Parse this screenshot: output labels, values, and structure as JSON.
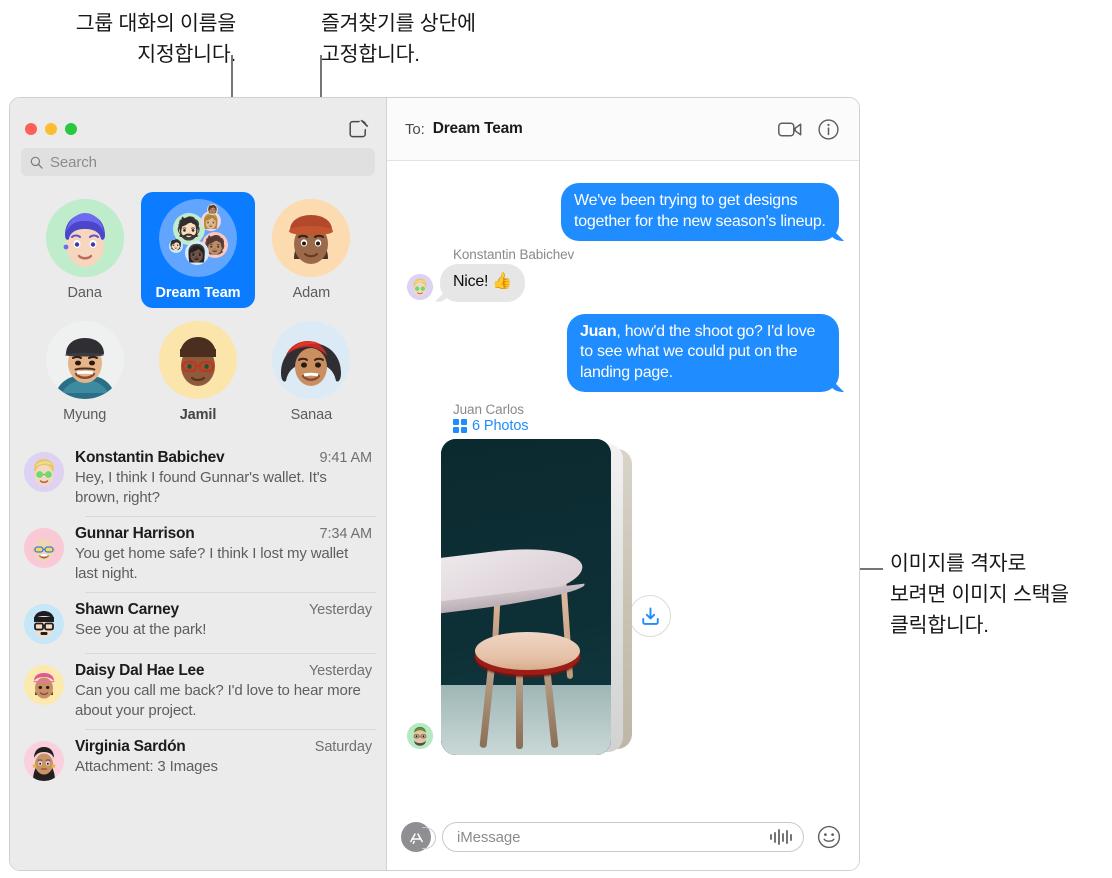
{
  "annotations": [
    {
      "id": "name-group",
      "text": "그룹 대화의 이름을\n지정합니다."
    },
    {
      "id": "pin-favorites",
      "text": "즐겨찾기를 상단에\n고정합니다."
    },
    {
      "id": "image-stack",
      "text": "이미지를 격자로\n보려면 이미지 스택을\n클릭합니다."
    }
  ],
  "window": {
    "titlebar": {
      "traffic_lights": [
        "close",
        "minimize",
        "zoom"
      ],
      "compose_icon": "compose-icon"
    },
    "search": {
      "placeholder": "Search",
      "icon": "search-icon"
    }
  },
  "pinned": {
    "items": [
      {
        "name": "Dana",
        "selected": false,
        "emoji": "👩🏻",
        "bg": "#bfeccb"
      },
      {
        "name": "Dream Team",
        "selected": true,
        "group": true,
        "bg": "#0b7bff"
      },
      {
        "name": "Adam",
        "selected": false,
        "emoji": "🧑🏽",
        "bg": "#fcdbb0"
      },
      {
        "name": "Myung",
        "selected": false,
        "emoji": "🧑🏻",
        "bg": "#f1f2f1"
      },
      {
        "name": "Jamil",
        "selected": false,
        "emoji": "👨🏾",
        "bg": "#fbe5ab"
      },
      {
        "name": "Sanaa",
        "selected": false,
        "emoji": "👩🏽",
        "bg": "#dceaf5"
      }
    ]
  },
  "conversations": [
    {
      "name": "Konstantin Babichev",
      "time": "9:41 AM",
      "preview": "Hey, I think I found Gunnar's wallet. It's brown, right?",
      "emoji": "🧑🏼",
      "bg": "#ddd2f2"
    },
    {
      "name": "Gunnar Harrison",
      "time": "7:34 AM",
      "preview": "You get home safe? I think I lost my wallet last night.",
      "emoji": "🧑🏼",
      "bg": "#f9c9d6"
    },
    {
      "name": "Shawn Carney",
      "time": "Yesterday",
      "preview": "See you at the park!",
      "emoji": "🧑🏻",
      "bg": "#c6e7f7"
    },
    {
      "name": "Daisy Dal Hae Lee",
      "time": "Yesterday",
      "preview": "Can you call me back? I'd love to hear more about your project.",
      "emoji": "👩🏽",
      "bg": "#fbe9ae"
    },
    {
      "name": "Virginia Sardón",
      "time": "Saturday",
      "preview": "Attachment: 3 Images",
      "emoji": "👩🏽",
      "bg": "#fbd0dd"
    }
  ],
  "pane": {
    "header": {
      "to_label": "To:",
      "to_value": "Dream Team",
      "facetime_icon": "video-camera-icon",
      "info_icon": "info-circle-icon"
    },
    "messages": [
      {
        "kind": "outgoing",
        "text": "We've been trying to get designs together for the new season's lineup."
      },
      {
        "kind": "incoming",
        "sender": "Konstantin Babichev",
        "text": "Nice! 👍",
        "avatar_emoji": "🧑🏼",
        "avatar_bg": "#ddd2f2"
      },
      {
        "kind": "outgoing",
        "bold_prefix": "Juan",
        "text": ", how'd the shoot go? I'd love to see what we could put on the landing page."
      }
    ],
    "attachment": {
      "sender": "Juan Carlos",
      "count_label": "6 Photos",
      "grid_icon": "grid-icon",
      "download_icon": "download-icon",
      "avatar_emoji": "🧔🏻",
      "avatar_bg": "#b7e8c0"
    },
    "composer": {
      "apps_icon": "app-store-icon",
      "placeholder": "iMessage",
      "audio_icon": "audio-waveform-icon",
      "emoji_icon": "smiley-icon"
    }
  },
  "colors": {
    "accent_blue": "#1f8cff",
    "selected_blue": "#0b7bff",
    "sidebar_bg": "#ebebeb",
    "incoming_bubble": "#e6e6e6"
  }
}
